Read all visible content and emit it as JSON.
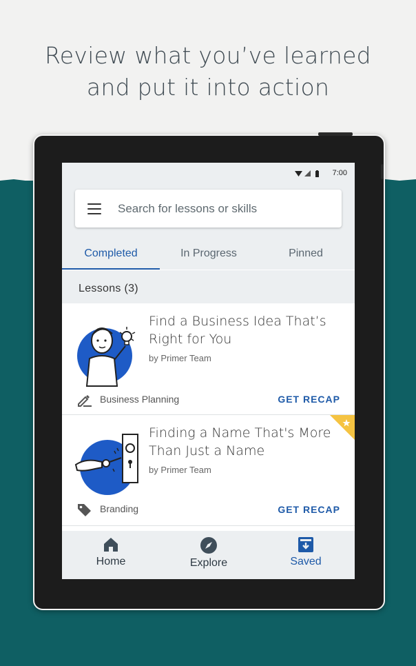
{
  "headline": {
    "line1": "Review what you’ve learned",
    "line2": "and put it into action"
  },
  "status_bar": {
    "time": "7:00"
  },
  "search": {
    "placeholder": "Search for lessons or skills"
  },
  "tabs": [
    {
      "label": "Completed",
      "active": true
    },
    {
      "label": "In Progress",
      "active": false
    },
    {
      "label": "Pinned",
      "active": false
    }
  ],
  "section": {
    "title": "Lessons (3)"
  },
  "lessons": [
    {
      "title_line1": "Find a Business Idea That’s",
      "title_line2": "Right for You",
      "author": "by Primer Team",
      "tag": "Business Planning",
      "tag_icon": "pencil-icon",
      "action": "GET RECAP",
      "pinned": false
    },
    {
      "title_line1": "Finding a Name That's More",
      "title_line2": "Than Just a Name",
      "author": "by Primer Team",
      "tag": "Branding",
      "tag_icon": "tag-icon",
      "action": "GET RECAP",
      "pinned": true
    }
  ],
  "bottom_nav": [
    {
      "label": "Home",
      "icon": "home-icon",
      "active": false
    },
    {
      "label": "Explore",
      "icon": "compass-icon",
      "active": false
    },
    {
      "label": "Saved",
      "icon": "saved-icon",
      "active": true
    }
  ],
  "colors": {
    "accent": "#1e5aa8",
    "teal_background": "#0f5f63",
    "pin_badge": "#f5c342",
    "illustration_blue": "#1e5bc6"
  }
}
